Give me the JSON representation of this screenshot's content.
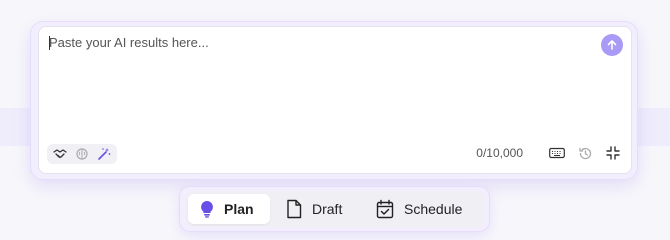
{
  "composer": {
    "placeholder": "Paste your AI results here...",
    "value": "",
    "char_counter": "0/10,000",
    "send_icon": "arrow-up-icon",
    "tool_icons": [
      "handshake-icon",
      "brain-icon",
      "magic-wand-icon"
    ],
    "right_icons": [
      "keyboard-icon",
      "history-icon",
      "collapse-icon"
    ]
  },
  "mode_tabs": [
    {
      "label": "Plan",
      "icon": "lightbulb-icon",
      "active": true
    },
    {
      "label": "Draft",
      "icon": "document-icon",
      "active": false
    },
    {
      "label": "Schedule",
      "icon": "calendar-check-icon",
      "active": false
    }
  ],
  "colors": {
    "accent": "#7c5cf0",
    "send_button": "#a99af5",
    "band": "#efedfc"
  }
}
